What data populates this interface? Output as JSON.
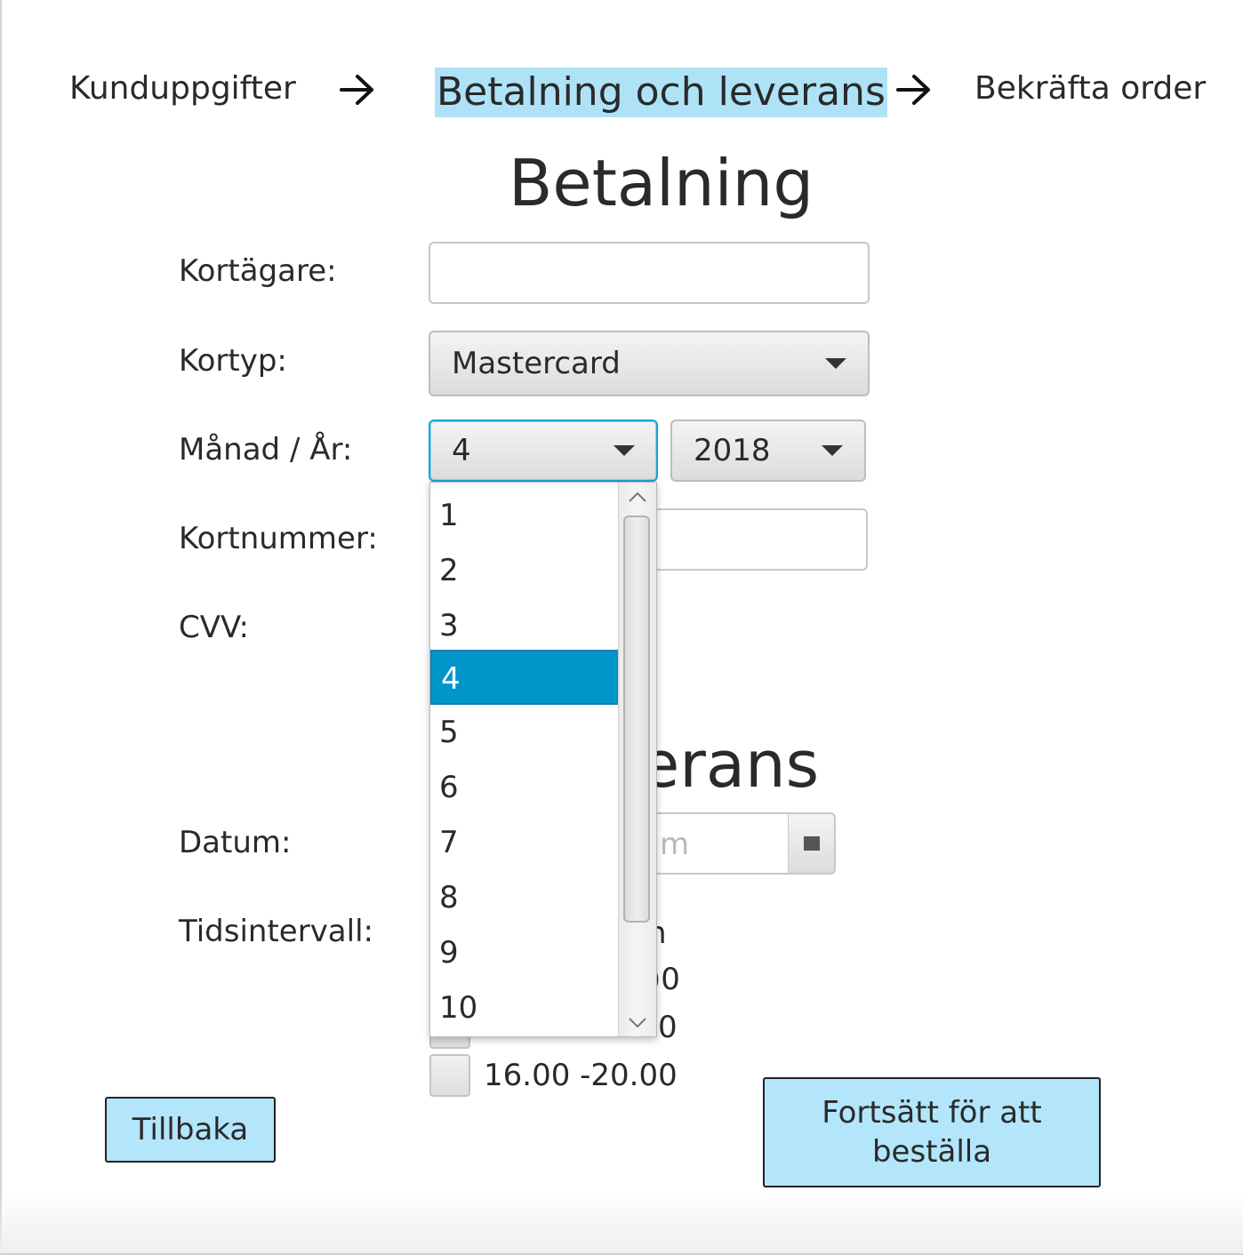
{
  "steps": {
    "step1": "Kunduppgifter",
    "step2": "Betalning och leverans",
    "step3": "Bekräfta order"
  },
  "payment": {
    "heading": "Betalning",
    "cardholder_label": "Kortägare:",
    "cardholder_value": "",
    "card_type_label": "Kortyp:",
    "card_type_value": "Mastercard",
    "month_year_label": "Månad / År:",
    "month_value": "4",
    "year_value": "2018",
    "card_number_label": "Kortnummer:",
    "cvv_label": "CVV:"
  },
  "delivery": {
    "heading_visible": "erans",
    "date_label": "Datum:",
    "date_placeholder_visible": "m",
    "interval_label": "Tidsintervall:",
    "interval_partial_1": "n",
    "interval_partial_2": ")0",
    "interval_partial_3": "0",
    "interval_last": "16.00 -20.00"
  },
  "month_dropdown": {
    "options": [
      "1",
      "2",
      "3",
      "4",
      "5",
      "6",
      "7",
      "8",
      "9",
      "10"
    ],
    "selected": "4"
  },
  "buttons": {
    "back": "Tillbaka",
    "continue_line1": "Fortsätt för att",
    "continue_line2": "beställa"
  },
  "colors": {
    "accent_light": "#aee3f7",
    "selected_option": "#0096c9",
    "focus_border": "#1aa3d6"
  }
}
